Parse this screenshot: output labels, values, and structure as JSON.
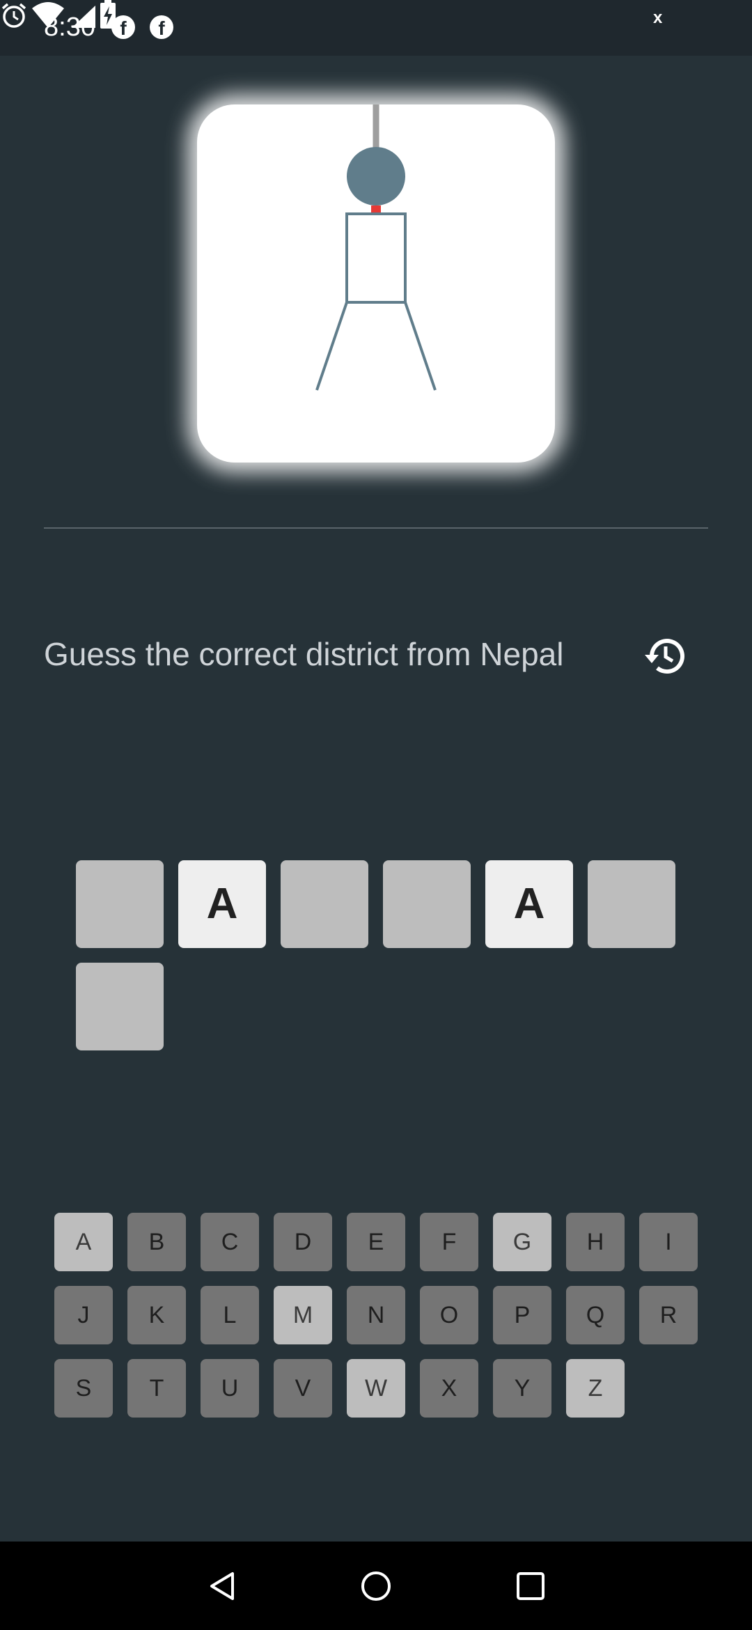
{
  "status_bar": {
    "time": "8:30",
    "notification_icons": [
      "facebook-icon",
      "facebook-icon"
    ],
    "system_icons": [
      "alarm-icon",
      "wifi-icon",
      "signal-icon",
      "battery-charging-icon"
    ],
    "wifi_badge": "x"
  },
  "game": {
    "prompt": "Guess the correct district from Nepal",
    "history_icon": "history-icon",
    "word_slots": [
      "",
      "A",
      "",
      "",
      "A",
      "",
      ""
    ],
    "keyboard": {
      "rows": [
        [
          "A",
          "B",
          "C",
          "D",
          "E",
          "F",
          "G",
          "H",
          "I"
        ],
        [
          "J",
          "K",
          "L",
          "M",
          "N",
          "O",
          "P",
          "Q",
          "R"
        ],
        [
          "S",
          "T",
          "U",
          "V",
          "W",
          "X",
          "Y",
          "Z"
        ]
      ],
      "used_letters": [
        "A",
        "G",
        "M",
        "W",
        "Z"
      ]
    },
    "colors": {
      "background": "#263238",
      "figure": "#607d8b",
      "rope": "#9e9e9e",
      "neck": "#e53935",
      "slot_empty": "#bdbdbd",
      "slot_revealed": "#eeeeee",
      "key_default": "#757575",
      "key_used": "#bdbdbd"
    }
  },
  "nav_bar": {
    "buttons": [
      "back-icon",
      "home-icon",
      "recents-icon"
    ]
  }
}
